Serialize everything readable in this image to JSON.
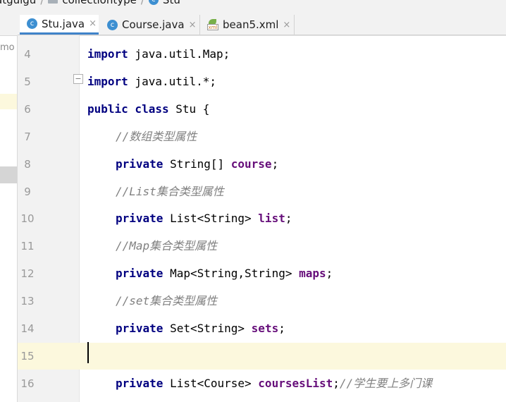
{
  "breadcrumb": {
    "items": [
      "atguigu",
      "collectiontype",
      "Stu"
    ]
  },
  "left_panel": {
    "text": "mo"
  },
  "tabs": [
    {
      "label": "Stu.java",
      "icon": "java-class-icon",
      "active": true,
      "close": "×"
    },
    {
      "label": "Course.java",
      "icon": "java-class-icon",
      "active": false,
      "close": "×"
    },
    {
      "label": "bean5.xml",
      "icon": "spring-xml-icon",
      "active": false,
      "close": "×"
    }
  ],
  "icon_glyph": "c",
  "editor": {
    "current_line": 15,
    "lines": [
      {
        "no": "4",
        "tokens": [
          {
            "t": "import",
            "c": "kw"
          },
          {
            "t": " java.util.Map;",
            "c": ""
          }
        ]
      },
      {
        "no": "5",
        "tokens": [
          {
            "t": "import",
            "c": "kw"
          },
          {
            "t": " java.util.*;",
            "c": ""
          }
        ]
      },
      {
        "no": "6",
        "tokens": [
          {
            "t": "public class",
            "c": "kw"
          },
          {
            "t": " Stu {",
            "c": ""
          }
        ]
      },
      {
        "no": "7",
        "indent": 1,
        "tokens": [
          {
            "t": "//数组类型属性",
            "c": "cmt"
          }
        ]
      },
      {
        "no": "8",
        "indent": 1,
        "tokens": [
          {
            "t": "private",
            "c": "kw"
          },
          {
            "t": " String[] ",
            "c": ""
          },
          {
            "t": "course",
            "c": "fld"
          },
          {
            "t": ";",
            "c": ""
          }
        ]
      },
      {
        "no": "9",
        "indent": 1,
        "tokens": [
          {
            "t": "//List集合类型属性",
            "c": "cmt"
          }
        ]
      },
      {
        "no": "10",
        "indent": 1,
        "tokens": [
          {
            "t": "private",
            "c": "kw"
          },
          {
            "t": " List<String> ",
            "c": ""
          },
          {
            "t": "list",
            "c": "fld"
          },
          {
            "t": ";",
            "c": ""
          }
        ]
      },
      {
        "no": "11",
        "indent": 1,
        "tokens": [
          {
            "t": "//Map集合类型属性",
            "c": "cmt"
          }
        ]
      },
      {
        "no": "12",
        "indent": 1,
        "tokens": [
          {
            "t": "private",
            "c": "kw"
          },
          {
            "t": " Map<String,String> ",
            "c": ""
          },
          {
            "t": "maps",
            "c": "fld"
          },
          {
            "t": ";",
            "c": ""
          }
        ]
      },
      {
        "no": "13",
        "indent": 1,
        "tokens": [
          {
            "t": "//set集合类型属性",
            "c": "cmt"
          }
        ]
      },
      {
        "no": "14",
        "indent": 1,
        "tokens": [
          {
            "t": "private",
            "c": "kw"
          },
          {
            "t": " Set<String> ",
            "c": ""
          },
          {
            "t": "sets",
            "c": "fld"
          },
          {
            "t": ";",
            "c": ""
          }
        ]
      },
      {
        "no": "15",
        "tokens": []
      },
      {
        "no": "16",
        "indent": 1,
        "tokens": [
          {
            "t": "private",
            "c": "kw"
          },
          {
            "t": " List<Course> ",
            "c": ""
          },
          {
            "t": "coursesList",
            "c": "fld"
          },
          {
            "t": ";",
            "c": ""
          },
          {
            "t": "//学生要上多门课",
            "c": "cmt"
          }
        ]
      }
    ]
  },
  "colors": {
    "keyword": "#000080",
    "field": "#660e7a",
    "comment": "#808080",
    "current_line_bg": "#fcf8dd",
    "tab_underline": "#4083c9"
  }
}
